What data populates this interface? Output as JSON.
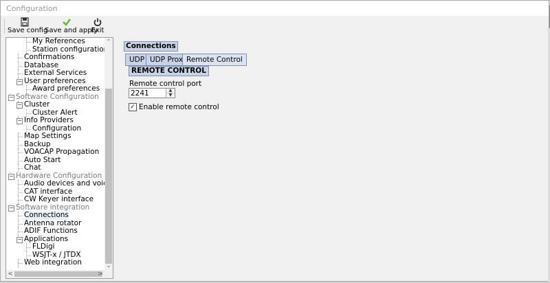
{
  "window": {
    "title": "Configuration"
  },
  "toolbar": {
    "save_config": "Save config",
    "save_apply": "Save and apply",
    "exit": "Exit",
    "icons": {
      "save_config": "floppy-icon",
      "save_apply": "checkmark-icon",
      "exit": "power-icon"
    },
    "accent_green": "#5cb82e"
  },
  "tree": {
    "items": [
      {
        "label": "My References",
        "level": 2,
        "gray": false
      },
      {
        "label": "Station configuration",
        "level": 2,
        "gray": false
      },
      {
        "label": "Confirmations",
        "level": 1,
        "gray": false
      },
      {
        "label": "Database",
        "level": 1,
        "gray": false
      },
      {
        "label": "External Services",
        "level": 1,
        "gray": false
      },
      {
        "label": "User preferences",
        "level": 1,
        "gray": false,
        "expander": "−"
      },
      {
        "label": "Award preferences",
        "level": 2,
        "gray": false
      },
      {
        "label": "Software Configuration",
        "level": 0,
        "gray": true,
        "expander": "−"
      },
      {
        "label": "Cluster",
        "level": 1,
        "gray": false,
        "expander": "−"
      },
      {
        "label": "Cluster Alert",
        "level": 2,
        "gray": false
      },
      {
        "label": "Info Providers",
        "level": 1,
        "gray": false,
        "expander": "−"
      },
      {
        "label": "Configuration",
        "level": 2,
        "gray": false
      },
      {
        "label": "Map Settings",
        "level": 1,
        "gray": false
      },
      {
        "label": "Backup",
        "level": 1,
        "gray": false
      },
      {
        "label": "VOACAP Propagation",
        "level": 1,
        "gray": false
      },
      {
        "label": "Auto Start",
        "level": 1,
        "gray": false
      },
      {
        "label": "Chat",
        "level": 1,
        "gray": false
      },
      {
        "label": "Hardware Configuration",
        "level": 0,
        "gray": true,
        "expander": "−"
      },
      {
        "label": "Audio devices and voice keye",
        "level": 1,
        "gray": false
      },
      {
        "label": "CAT interface",
        "level": 1,
        "gray": false
      },
      {
        "label": "CW Keyer interface",
        "level": 1,
        "gray": false
      },
      {
        "label": "Software integration",
        "level": 0,
        "gray": true,
        "expander": "−"
      },
      {
        "label": "Connections",
        "level": 1,
        "gray": false,
        "selected": true
      },
      {
        "label": "Antenna rotator",
        "level": 1,
        "gray": false
      },
      {
        "label": "ADIF Functions",
        "level": 1,
        "gray": false
      },
      {
        "label": "Applications",
        "level": 1,
        "gray": false,
        "expander": "−"
      },
      {
        "label": "FLDigi",
        "level": 2,
        "gray": false
      },
      {
        "label": "WSJT-x / JTDX",
        "level": 2,
        "gray": false
      },
      {
        "label": "Web integration",
        "level": 1,
        "gray": false
      }
    ],
    "scroll_up": "⌃",
    "scroll_down": "⌄",
    "scroll_left": "<",
    "scroll_right": ">"
  },
  "panel": {
    "heading": "Connections",
    "tabs": [
      {
        "label": "UDP",
        "active": false
      },
      {
        "label": "UDP Proxy",
        "active": false
      },
      {
        "label": "Remote Control",
        "active": true
      }
    ],
    "group_title": "REMOTE CONTROL",
    "port_label": "Remote control port",
    "port_value": "2241",
    "enable_label": "Enable remote control",
    "enable_checked": true,
    "check_glyph": "✓"
  }
}
